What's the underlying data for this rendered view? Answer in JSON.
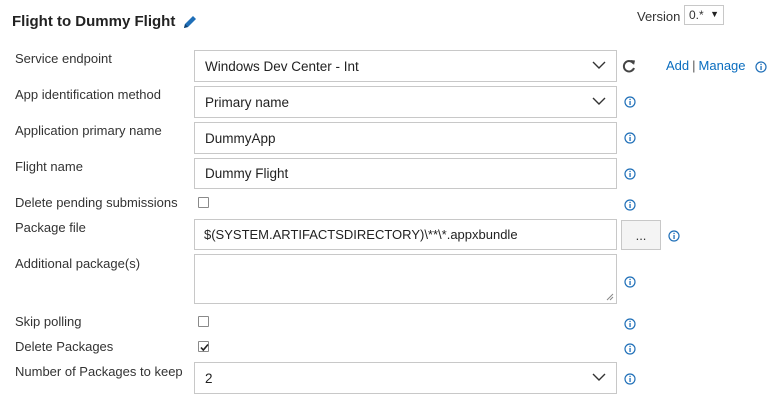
{
  "header": {
    "title": "Flight to Dummy Flight",
    "edit_icon": "pencil-icon",
    "version_label": "Version",
    "version_value": "0.*"
  },
  "form": {
    "service_endpoint": {
      "label": "Service endpoint",
      "value": "Windows Dev Center - Int",
      "add_link": "Add",
      "separator": "|",
      "manage_link": "Manage"
    },
    "app_identification_method": {
      "label": "App identification method",
      "value": "Primary name"
    },
    "application_primary_name": {
      "label": "Application primary name",
      "value": "DummyApp"
    },
    "flight_name": {
      "label": "Flight name",
      "value": "Dummy Flight"
    },
    "delete_pending_submissions": {
      "label": "Delete pending submissions",
      "checked": false
    },
    "package_file": {
      "label": "Package file",
      "value": "$(SYSTEM.ARTIFACTSDIRECTORY)\\**\\*.appxbundle",
      "browse_label": "..."
    },
    "additional_packages": {
      "label": "Additional package(s)",
      "value": ""
    },
    "skip_polling": {
      "label": "Skip polling",
      "checked": false
    },
    "delete_packages": {
      "label": "Delete Packages",
      "checked": true
    },
    "packages_to_keep": {
      "label": "Number of Packages to keep",
      "value": "2"
    }
  },
  "colors": {
    "link": "#0a6dbf",
    "info_icon": "#1f6fb8",
    "border": "#c8c8c8"
  }
}
